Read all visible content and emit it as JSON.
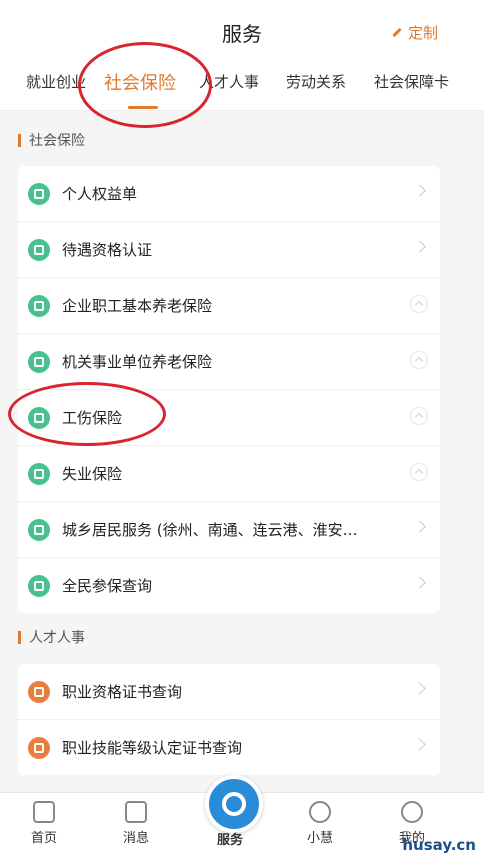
{
  "header": {
    "title": "服务",
    "custom_label": "定制"
  },
  "tabs": [
    {
      "label": "就业创业"
    },
    {
      "label": "社会保险"
    },
    {
      "label": "人才人事"
    },
    {
      "label": "劳动关系"
    },
    {
      "label": "社会保障卡"
    }
  ],
  "sections": [
    {
      "title": "社会保险",
      "items": [
        {
          "label": "个人权益单",
          "icon": "document-icon",
          "expand": false
        },
        {
          "label": "待遇资格认证",
          "icon": "certificate-icon",
          "expand": false
        },
        {
          "label": "企业职工基本养老保险",
          "icon": "box-icon",
          "expand": true
        },
        {
          "label": "机关事业单位养老保险",
          "icon": "box-icon",
          "expand": true
        },
        {
          "label": "工伤保险",
          "icon": "box-icon",
          "expand": true
        },
        {
          "label": "失业保险",
          "icon": "box-icon",
          "expand": true
        },
        {
          "label": "城乡居民服务 (徐州、南通、连云港、淮安…",
          "icon": "photo-icon",
          "expand": false
        },
        {
          "label": "全民参保查询",
          "icon": "search-doc-icon",
          "expand": false
        }
      ]
    },
    {
      "title": "人才人事",
      "items": [
        {
          "label": "职业资格证书查询",
          "icon": "certificate-icon",
          "expand": false
        },
        {
          "label": "职业技能等级认定证书查询",
          "icon": "certificate-icon",
          "expand": false
        }
      ]
    }
  ],
  "bottom_nav": [
    {
      "label": "首页",
      "icon": "home-icon"
    },
    {
      "label": "消息",
      "icon": "speaker-icon"
    },
    {
      "label": "服务",
      "icon": "service-logo-icon"
    },
    {
      "label": "小慧",
      "icon": "assistant-icon"
    },
    {
      "label": "我的",
      "icon": "user-icon"
    }
  ],
  "watermark": "husay.cn",
  "colors": {
    "accent": "#e07a2f",
    "annotation": "#d9232d",
    "green_icon": "#4bbf8f",
    "orange_icon": "#ea7d3b"
  }
}
